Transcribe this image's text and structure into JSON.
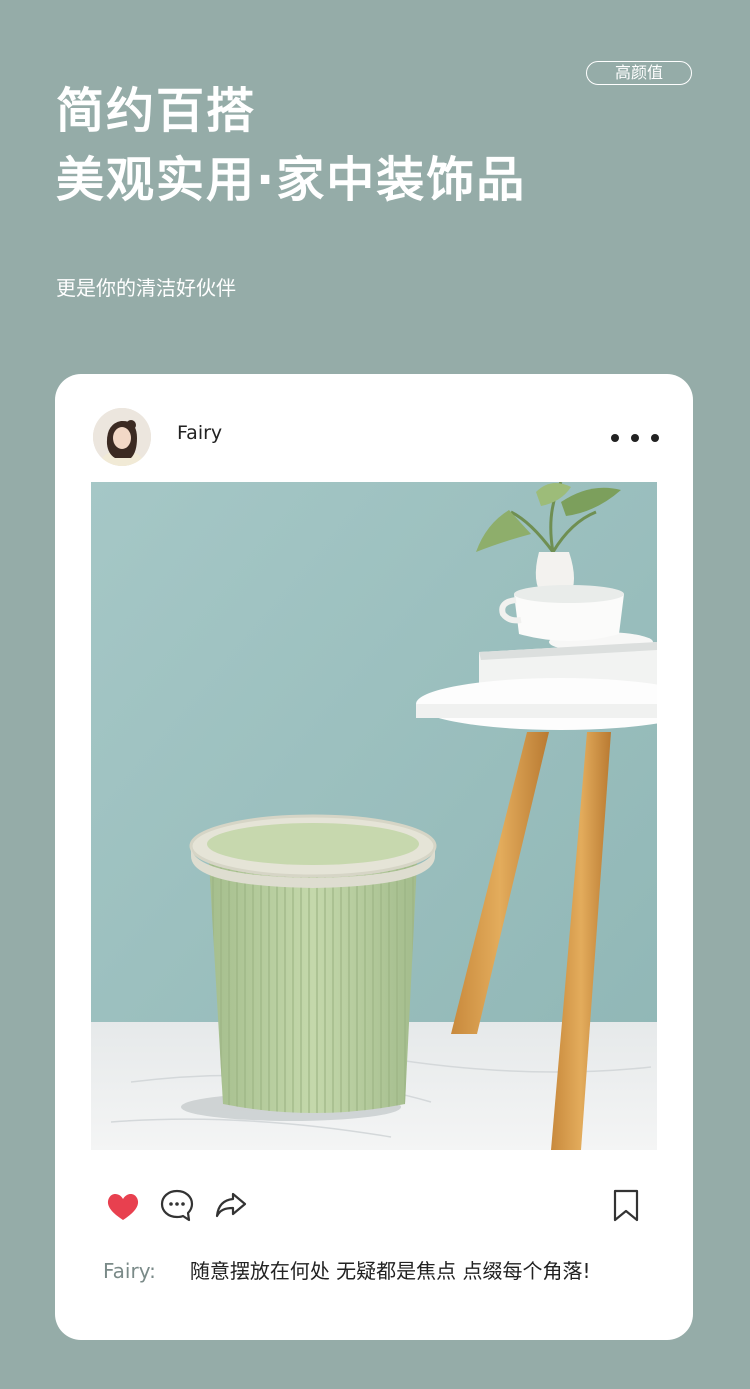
{
  "badge": "高颜值",
  "headline": {
    "line1": "简约百搭",
    "line2": "美观实用·家中装饰品"
  },
  "subtitle": "更是你的清洁好伙伴",
  "post": {
    "username": "Fairy",
    "caption_user": "Fairy:",
    "caption_text": "随意摆放在何处 无疑都是焦点 点缀每个角落!",
    "liked": true
  },
  "colors": {
    "background": "#95aca8",
    "card": "#ffffff",
    "like": "#e8404f"
  },
  "icons": [
    "more-icon",
    "heart-icon",
    "comment-icon",
    "share-icon",
    "bookmark-icon"
  ]
}
